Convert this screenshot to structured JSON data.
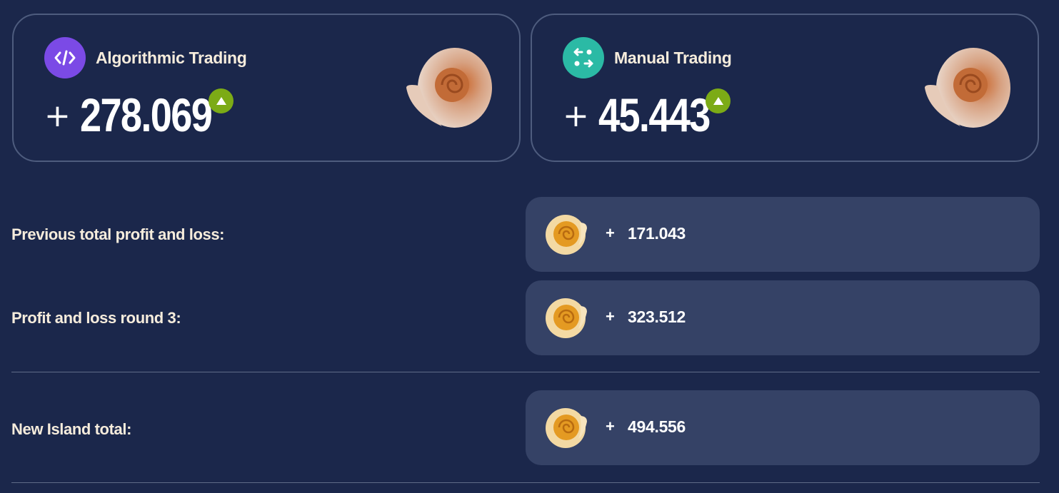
{
  "cards": [
    {
      "title": "Algorithmic Trading",
      "sign": "+",
      "amount": "278.069",
      "icon": "code-icon",
      "icon_color": "#7b4ae6",
      "trend": "up"
    },
    {
      "title": "Manual Trading",
      "sign": "+",
      "amount": "45.443",
      "icon": "swap-arrows-icon",
      "icon_color": "#2bbaa5",
      "trend": "up"
    }
  ],
  "rows": [
    {
      "label": "Previous total profit and loss:",
      "sign": "+",
      "value": "171.043"
    },
    {
      "label": "Profit and loss round 3:",
      "sign": "+",
      "value": "323.512"
    },
    {
      "label": "New Island total:",
      "sign": "+",
      "value": "494.556"
    }
  ],
  "colors": {
    "background": "#1b274b",
    "row_box": "#354266",
    "up_badge": "#7cab16"
  }
}
